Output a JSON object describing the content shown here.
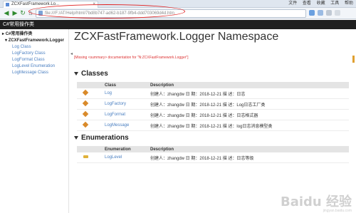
{
  "browser": {
    "tab_title": "ZCXFastFramework.Lo...",
    "tab_close": "×",
    "window_menu": [
      "文件",
      "查看",
      "收藏",
      "工具",
      "帮助"
    ],
    "address": "file:///F:/AT/Help/html/7bd8b747-ad62-b187-9fb4-ddd703069d4d.htm",
    "nav": {
      "back": "◀",
      "forward": "▶",
      "reload": "↻",
      "home": "⌂"
    }
  },
  "banner": {
    "title": "C#常用操作类"
  },
  "sidebar": {
    "root": "C#常用操作类",
    "namespace": "ZCXFastFramework.Logger",
    "items": [
      "Log Class",
      "LogFactory Class",
      "LogFormat Class",
      "LogLevel Enumeration",
      "LogMessage Class"
    ]
  },
  "content": {
    "title": "ZCXFastFramework.Logger Namespace",
    "missing": "[Missing <summary> documentation for \"N:ZCXFastFramework.Logger\"]",
    "classes": {
      "heading": "Classes",
      "col_class": "Class",
      "col_desc": "Description",
      "rows": [
        {
          "name": "Log",
          "desc": "创建人：zhangdw 日 期：2018-12-21 描 述：日志"
        },
        {
          "name": "LogFactory",
          "desc": "创建人：zhangdw 日 期：2018-12-21 描 述：Log日志工厂类"
        },
        {
          "name": "LogFormat",
          "desc": "创建人：zhangdw 日 期：2018-12-21 描 述：日志格式器"
        },
        {
          "name": "LogMessage",
          "desc": "创建人：zhangdw 日 期：2018-12-21 描 述：log日志消息模型类"
        }
      ]
    },
    "enums": {
      "heading": "Enumerations",
      "col_enum": "Enumeration",
      "col_desc": "Description",
      "rows": [
        {
          "name": "LogLevel",
          "desc": "创建人：zhangdw 日 期：2018-12-21 描 述：日志等级"
        }
      ]
    }
  },
  "watermark": {
    "main": "Baidu 经验",
    "sub": "jingyan.baidu.com"
  },
  "colors": {
    "link": "#4a7fc1",
    "banner": "#1f1f1f",
    "highlight": "#e02020"
  }
}
